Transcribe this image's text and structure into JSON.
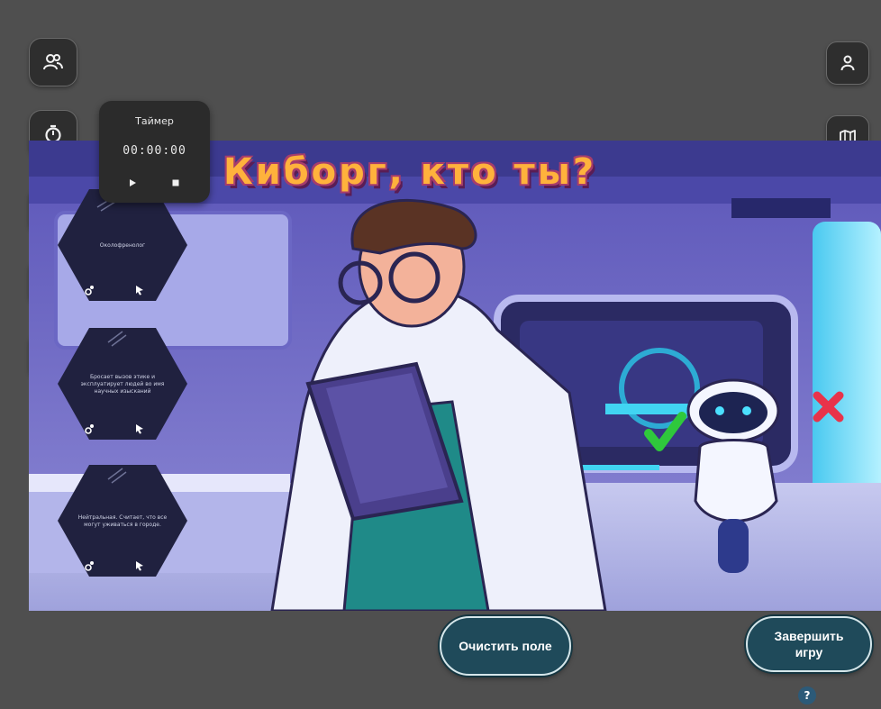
{
  "game": {
    "title": "Киборг, кто ты?"
  },
  "left_toolbar": [
    {
      "icon": "users-icon"
    },
    {
      "icon": "stopwatch-icon"
    },
    {
      "icon": "notes-icon"
    },
    {
      "icon": "bar-chart-icon"
    },
    {
      "icon": "question-icon",
      "glyph": "?"
    }
  ],
  "right_toolbar": [
    {
      "icon": "user-icon"
    },
    {
      "icon": "map-icon"
    },
    {
      "icon": "bell-icon"
    }
  ],
  "timer": {
    "title": "Таймер",
    "time": "00:00:00",
    "controls": [
      "play-icon",
      "stop-icon"
    ]
  },
  "cards": [
    {
      "text": "Околофренолог",
      "icons": [
        "steps-icon",
        "cursor-icon"
      ]
    },
    {
      "text": "Бросает вызов этике и эксплуатирует людей во имя научных изысканий",
      "icons": [
        "steps-icon",
        "cursor-icon"
      ]
    },
    {
      "text": "Нейтральная. Считает, что все могут уживаться в городе.",
      "icons": [
        "steps-icon",
        "cursor-icon"
      ]
    }
  ],
  "actions": {
    "clear_label": "Очистить поле",
    "finish_label": "Завершить игру",
    "help_glyph": "?"
  },
  "colors": {
    "background": "#4f4f4f",
    "button_fill": "#1f4a5a",
    "button_border": "#d5e6ea",
    "title_orange": "#ffb23c",
    "title_outline": "#a63d6c"
  }
}
